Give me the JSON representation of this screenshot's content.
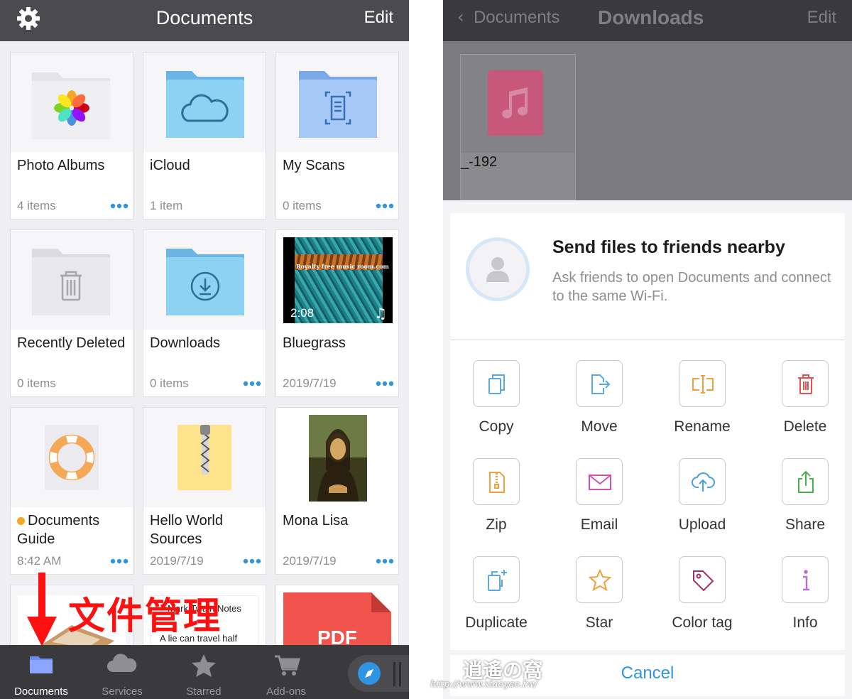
{
  "left": {
    "nav": {
      "title": "Documents",
      "edit": "Edit"
    },
    "items": [
      {
        "name": "Photo Albums",
        "sub": "4 items",
        "icon": "photos-folder-icon"
      },
      {
        "name": "iCloud",
        "sub": "1 item",
        "icon": "icloud-folder-icon"
      },
      {
        "name": "My Scans",
        "sub": "0 items",
        "icon": "scans-folder-icon"
      },
      {
        "name": "Recently Deleted",
        "sub": "0 items",
        "icon": "trash-folder-icon"
      },
      {
        "name": "Downloads",
        "sub": "0 items",
        "icon": "download-folder-icon"
      },
      {
        "name": "Bluegrass",
        "sub": "2019/7/19",
        "duration": "2:08",
        "thumb_text": "Royalty free music room.com",
        "icon": "video-thumb"
      },
      {
        "name": "Documents Guide",
        "sub": "8:42 AM",
        "icon": "lifebuoy-icon"
      },
      {
        "name": "Hello World Sources",
        "sub": "2019/7/19",
        "icon": "zip-file-icon"
      },
      {
        "name": "Mona Lisa",
        "sub": "2019/7/19",
        "icon": "painting-thumb"
      }
    ],
    "partial_row": {
      "notes_title": "Notes",
      "notes_line": "A lie can travel half",
      "pdf_label": "PDF"
    },
    "tabs": [
      {
        "label": "Documents",
        "active": true
      },
      {
        "label": "Services"
      },
      {
        "label": "Starred"
      },
      {
        "label": "Add-ons"
      }
    ],
    "annotation": "文件管理",
    "colors": {
      "nav": "#4a4a4f",
      "accent": "#2f95e0",
      "annotation": "#ff1010"
    }
  },
  "right": {
    "nav": {
      "back": "Documents",
      "title": "Downloads",
      "edit": "Edit"
    },
    "file": {
      "name": "_-192"
    },
    "sheet": {
      "title": "Send files to friends nearby",
      "desc": "Ask friends to open Documents and connect to the same Wi-Fi."
    },
    "actions": [
      {
        "label": "Copy",
        "icon": "copy-icon"
      },
      {
        "label": "Move",
        "icon": "move-icon"
      },
      {
        "label": "Rename",
        "icon": "rename-icon"
      },
      {
        "label": "Delete",
        "icon": "delete-icon"
      },
      {
        "label": "Zip",
        "icon": "zip-icon"
      },
      {
        "label": "Email",
        "icon": "email-icon"
      },
      {
        "label": "Upload",
        "icon": "upload-icon"
      },
      {
        "label": "Share",
        "icon": "share-icon"
      },
      {
        "label": "Duplicate",
        "icon": "duplicate-icon"
      },
      {
        "label": "Star",
        "icon": "star-icon"
      },
      {
        "label": "Color tag",
        "icon": "tag-icon"
      },
      {
        "label": "Info",
        "icon": "info-icon"
      }
    ],
    "cancel": "Cancel"
  },
  "watermark": {
    "line1": "逍遙の窩",
    "line2": "http://www.xiaoyao.tw/"
  }
}
